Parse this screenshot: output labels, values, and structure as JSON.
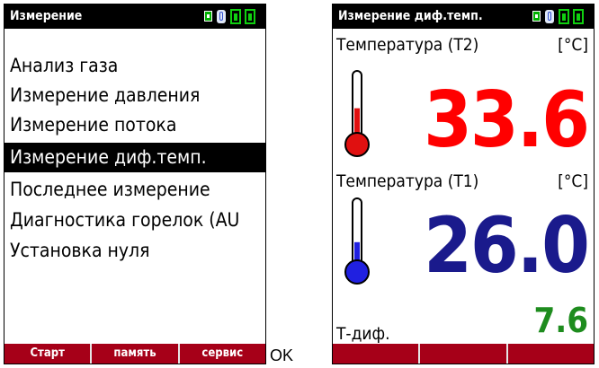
{
  "left_screen": {
    "title": "Измерение",
    "menu_items": [
      "Анализ газа",
      "Измерение давления",
      "Измерение потока",
      "Измерение диф.темп.",
      "Последнее измерение",
      "Диагностика горелок (AU",
      "Установка нуля"
    ],
    "selected_index": 3,
    "softkeys": [
      "Старт",
      "память",
      "сервис"
    ]
  },
  "ok_label": "OK",
  "right_screen": {
    "title": "Измерение диф.темп.",
    "t2": {
      "label": "Температура (T2)",
      "unit": "[°C]",
      "value": "33.6",
      "color": "#ff0000",
      "thermometer_level": 0.45,
      "thermometer_color": "#e01010"
    },
    "t1": {
      "label": "Температура (T1)",
      "unit": "[°C]",
      "value": "26.0",
      "color": "#1a1a8c",
      "thermometer_level": 0.35,
      "thermometer_color": "#2020e0"
    },
    "delta": {
      "label": "Т-диф.",
      "value": "7.6",
      "color": "#1e8c1e"
    },
    "softkeys": [
      "",
      "",
      ""
    ]
  },
  "colors": {
    "accent": "#a60018",
    "status_green": "#10d010"
  },
  "icons": [
    "probe-icon",
    "bluetooth-icon",
    "battery-icon",
    "battery-icon",
    "thermometer-icon"
  ]
}
